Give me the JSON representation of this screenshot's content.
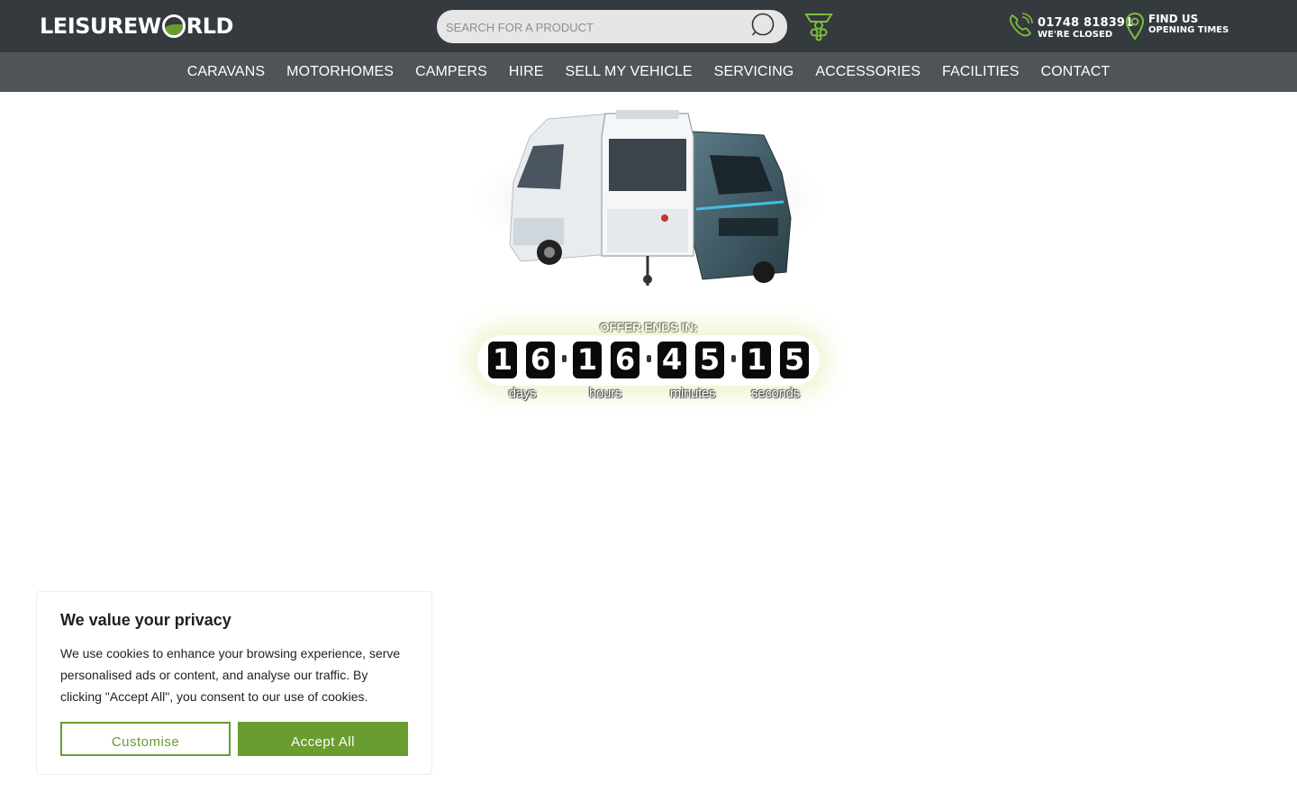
{
  "header": {
    "logo_text_left": "LEISUREW",
    "logo_text_right": "RLD",
    "search_placeholder": "SEARCH FOR A PRODUCT",
    "phone_number": "01748 818391",
    "phone_status": "WE'RE CLOSED",
    "findus_title": "FIND US",
    "findus_sub": "OPENING TIMES"
  },
  "nav": {
    "items": [
      {
        "label": "CARAVANS"
      },
      {
        "label": "MOTORHOMES"
      },
      {
        "label": "CAMPERS"
      },
      {
        "label": "HIRE"
      },
      {
        "label": "SELL MY VEHICLE"
      },
      {
        "label": "SERVICING"
      },
      {
        "label": "ACCESSORIES"
      },
      {
        "label": "FACILITIES"
      },
      {
        "label": "CONTACT"
      }
    ]
  },
  "countdown": {
    "label": "OFFER ENDS IN:",
    "days": [
      "1",
      "6"
    ],
    "hours": [
      "1",
      "6"
    ],
    "minutes": [
      "4",
      "5"
    ],
    "seconds": [
      "1",
      "5"
    ],
    "unit_days": "days",
    "unit_hours": "hours",
    "unit_minutes": "minutes",
    "unit_seconds": "seconds"
  },
  "cookie": {
    "title": "We value your privacy",
    "text": "We use cookies to enhance your browsing experience, serve personalised ads or content, and analyse our traffic. By clicking \"Accept All\", you consent to our use of cookies.",
    "customise_label": "Customise",
    "accept_label": "Accept All"
  },
  "colors": {
    "topbar": "#353a3f",
    "nav": "#4f5458",
    "accent_green": "#6a9d2f",
    "icon_green": "#7cbf3a"
  },
  "icons": {
    "search": "search-icon",
    "wheel": "steering-wheel-icon",
    "phone": "phone-icon",
    "location": "map-pin-icon"
  }
}
